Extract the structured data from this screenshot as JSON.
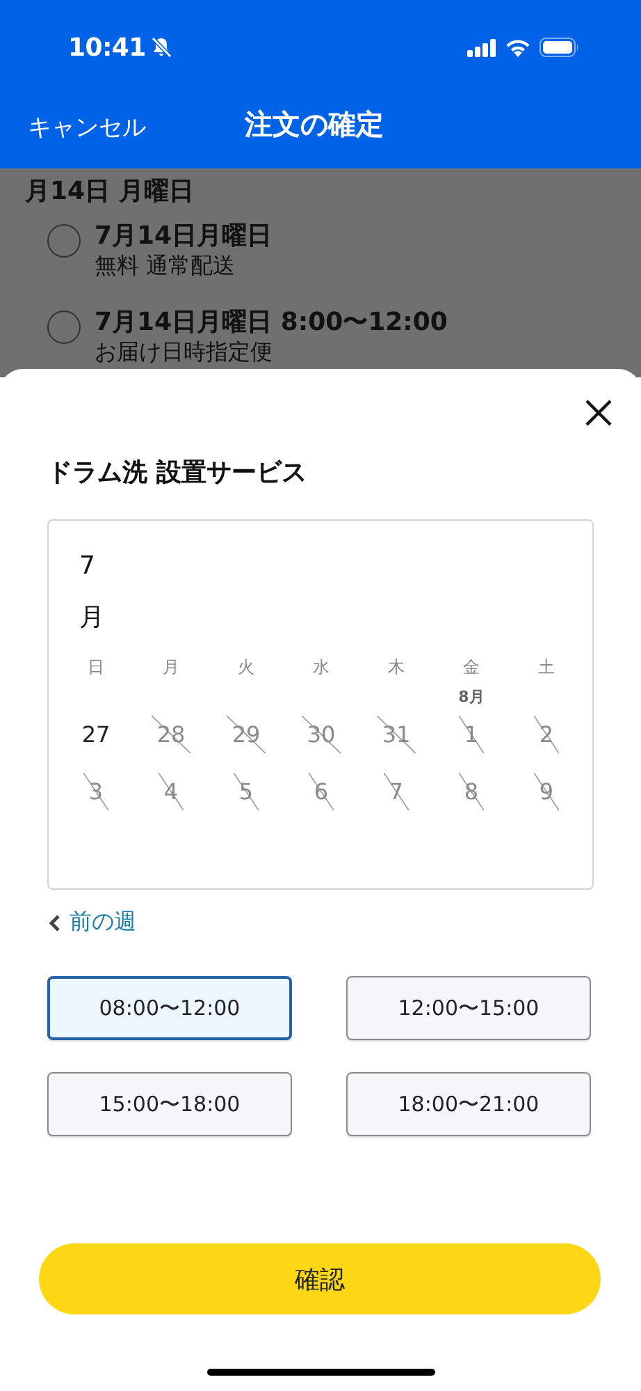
{
  "status_bar": {
    "time": "10:41",
    "silent": true
  },
  "nav": {
    "cancel": "キャンセル",
    "title": "注文の確定"
  },
  "background": {
    "heading": "月14日 月曜日",
    "options": [
      {
        "title": "7月14日月曜日",
        "subtitle": "無料 通常配送",
        "selected": false
      },
      {
        "title": "7月14日月曜日 8:00〜12:00",
        "subtitle": "お届け日時指定便",
        "selected": false
      }
    ]
  },
  "sheet": {
    "title": "ドラム洗 設置サービス",
    "calendar": {
      "month": "7月",
      "weekdays": [
        "日",
        "月",
        "火",
        "水",
        "木",
        "金",
        "土"
      ],
      "days": [
        {
          "label": "27",
          "disabled": false
        },
        {
          "label": "28",
          "disabled": true
        },
        {
          "label": "29",
          "disabled": true
        },
        {
          "label": "30",
          "disabled": true
        },
        {
          "label": "31",
          "disabled": true
        },
        {
          "label": "1",
          "disabled": true,
          "month_label": "8月"
        },
        {
          "label": "2",
          "disabled": true
        },
        {
          "label": "3",
          "disabled": true
        },
        {
          "label": "4",
          "disabled": true
        },
        {
          "label": "5",
          "disabled": true
        },
        {
          "label": "6",
          "disabled": true
        },
        {
          "label": "7",
          "disabled": true
        },
        {
          "label": "8",
          "disabled": true
        },
        {
          "label": "9",
          "disabled": true
        }
      ]
    },
    "prev_week": "前の週",
    "time_slots": [
      {
        "label": "08:00〜12:00",
        "selected": true
      },
      {
        "label": "12:00〜15:00",
        "selected": false
      },
      {
        "label": "15:00〜18:00",
        "selected": false
      },
      {
        "label": "18:00〜21:00",
        "selected": false
      }
    ],
    "confirm": "確認"
  }
}
